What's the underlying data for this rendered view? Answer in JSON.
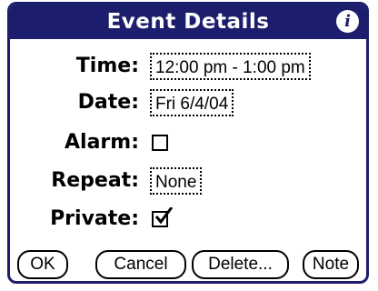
{
  "dialog": {
    "title": "Event Details",
    "info_icon": "i"
  },
  "fields": {
    "time_label": "Time:",
    "time_value": "12:00 pm - 1:00 pm",
    "date_label": "Date:",
    "date_value": "Fri 6/4/04",
    "alarm_label": "Alarm:",
    "alarm_checked": false,
    "repeat_label": "Repeat:",
    "repeat_value": "None",
    "private_label": "Private:",
    "private_checked": true
  },
  "buttons": {
    "ok": "OK",
    "cancel": "Cancel",
    "delete": "Delete...",
    "note": "Note"
  },
  "colors": {
    "title_bar": "#1d1d6e",
    "background": "#ffffff",
    "text": "#000000"
  },
  "icons": {
    "info": "info-icon",
    "check": "checkmark-icon"
  }
}
